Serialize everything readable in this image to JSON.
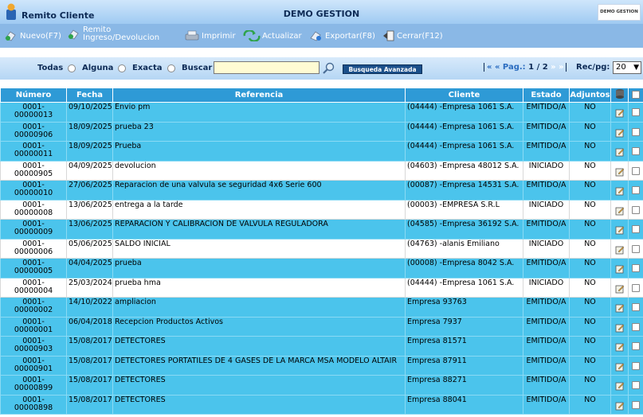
{
  "app": {
    "title": "Remito Cliente",
    "company": "DEMO GESTION",
    "company_logo_text": "DEMO GESTION"
  },
  "toolbar": {
    "nuevo": "Nuevo(F7)",
    "remito_line1": "Remito",
    "remito_line2": "Ingreso/Devolucion",
    "imprimir": "Imprimir",
    "actualizar": "Actualizar",
    "exportar": "Exportar(F8)",
    "cerrar": "Cerrar(F12)"
  },
  "search": {
    "opt_todas": "Todas",
    "opt_alguna": "Alguna",
    "opt_exacta": "Exacta",
    "opt_buscar": "Buscar",
    "value": "",
    "advanced_button": "Busqueda Avanzada",
    "pager_prefix": "« « Pag.:",
    "pager_current": "1 / 2",
    "pager_next": "» »",
    "rec_label": "Rec/pg:",
    "rec_value": "20"
  },
  "table": {
    "headers": {
      "numero": "Número",
      "fecha": "Fecha",
      "referencia": "Referencia",
      "cliente": "Cliente",
      "estado": "Estado",
      "adjuntos": "Adjuntos"
    },
    "rows": [
      {
        "num1": "0001-",
        "num2": "00000013",
        "fecha": "09/10/2025",
        "ref": "Envio pm",
        "cliente": "(04444) -Empresa 1061 S.A.",
        "estado": "EMITIDO/A",
        "adj": "NO"
      },
      {
        "num1": "0001-",
        "num2": "00000906",
        "fecha": "18/09/2025",
        "ref": "prueba 23",
        "cliente": "(04444) -Empresa 1061 S.A.",
        "estado": "EMITIDO/A",
        "adj": "NO"
      },
      {
        "num1": "0001-",
        "num2": "00000011",
        "fecha": "18/09/2025",
        "ref": "Prueba",
        "cliente": "(04444) -Empresa 1061 S.A.",
        "estado": "EMITIDO/A",
        "adj": "NO"
      },
      {
        "num1": "0001-",
        "num2": "00000905",
        "fecha": "04/09/2025",
        "ref": "devolucion",
        "cliente": "(04603) -Empresa 48012 S.A.",
        "estado": "INICIADO",
        "adj": "NO"
      },
      {
        "num1": "0001-",
        "num2": "00000010",
        "fecha": "27/06/2025",
        "ref": "Reparacion de una valvula se seguridad 4x6 Serie 600",
        "cliente": "(00087) -Empresa 14531 S.A.",
        "estado": "EMITIDO/A",
        "adj": "NO"
      },
      {
        "num1": "0001-",
        "num2": "00000008",
        "fecha": "13/06/2025",
        "ref": "entrega a la tarde",
        "cliente": "(00003) -EMPRESA S.R.L",
        "estado": "INICIADO",
        "adj": "NO"
      },
      {
        "num1": "0001-",
        "num2": "00000009",
        "fecha": "13/06/2025",
        "ref": "REPARACION Y CALIBRACIÓN DE VÁLVULA REGULADORA",
        "cliente": "(04585) -Empresa 36192 S.A.",
        "estado": "EMITIDO/A",
        "adj": "NO"
      },
      {
        "num1": "0001-",
        "num2": "00000006",
        "fecha": "05/06/2025",
        "ref": "SALDO INICIAL",
        "cliente": "(04763) -alanis Emiliano",
        "estado": "INICIADO",
        "adj": "NO"
      },
      {
        "num1": "0001-",
        "num2": "00000005",
        "fecha": "04/04/2025",
        "ref": "prueba",
        "cliente": "(00008) -Empresa 8042 S.A.",
        "estado": "EMITIDO/A",
        "adj": "NO"
      },
      {
        "num1": "0001-",
        "num2": "00000004",
        "fecha": "25/03/2024",
        "ref": "prueba hma",
        "cliente": "(04444) -Empresa 1061 S.A.",
        "estado": "INICIADO",
        "adj": "NO"
      },
      {
        "num1": "0001-",
        "num2": "00000002",
        "fecha": "14/10/2022",
        "ref": "ampliacion",
        "cliente": "Empresa 93763",
        "estado": "EMITIDO/A",
        "adj": "NO"
      },
      {
        "num1": "0001-",
        "num2": "00000001",
        "fecha": "06/04/2018",
        "ref": "Recepcion Productos Activos",
        "cliente": "Empresa 7937",
        "estado": "EMITIDO/A",
        "adj": "NO"
      },
      {
        "num1": "0001-",
        "num2": "00000903",
        "fecha": "15/08/2017",
        "ref": "DETECTORES",
        "cliente": "Empresa 81571",
        "estado": "EMITIDO/A",
        "adj": "NO"
      },
      {
        "num1": "0001-",
        "num2": "00000901",
        "fecha": "15/08/2017",
        "ref": "DETECTORES PORTATILES DE 4 GASES DE LA MARCA MSA MODELO ALTAIR",
        "cliente": "Empresa 87911",
        "estado": "EMITIDO/A",
        "adj": "NO"
      },
      {
        "num1": "0001-",
        "num2": "00000899",
        "fecha": "15/08/2017",
        "ref": "DETECTORES",
        "cliente": "Empresa 88271",
        "estado": "EMITIDO/A",
        "adj": "NO"
      },
      {
        "num1": "0001-",
        "num2": "00000898",
        "fecha": "15/08/2017",
        "ref": "DETECTORES",
        "cliente": "Empresa 88041",
        "estado": "EMITIDO/A",
        "adj": "NO"
      }
    ]
  },
  "colors": {
    "header_bar": "#9fcaf2",
    "toolbar": "#8ab8e6",
    "table_header": "#2e9ad6",
    "row_emitido": "#4bc4ec",
    "row_iniciado": "#ffffff"
  }
}
